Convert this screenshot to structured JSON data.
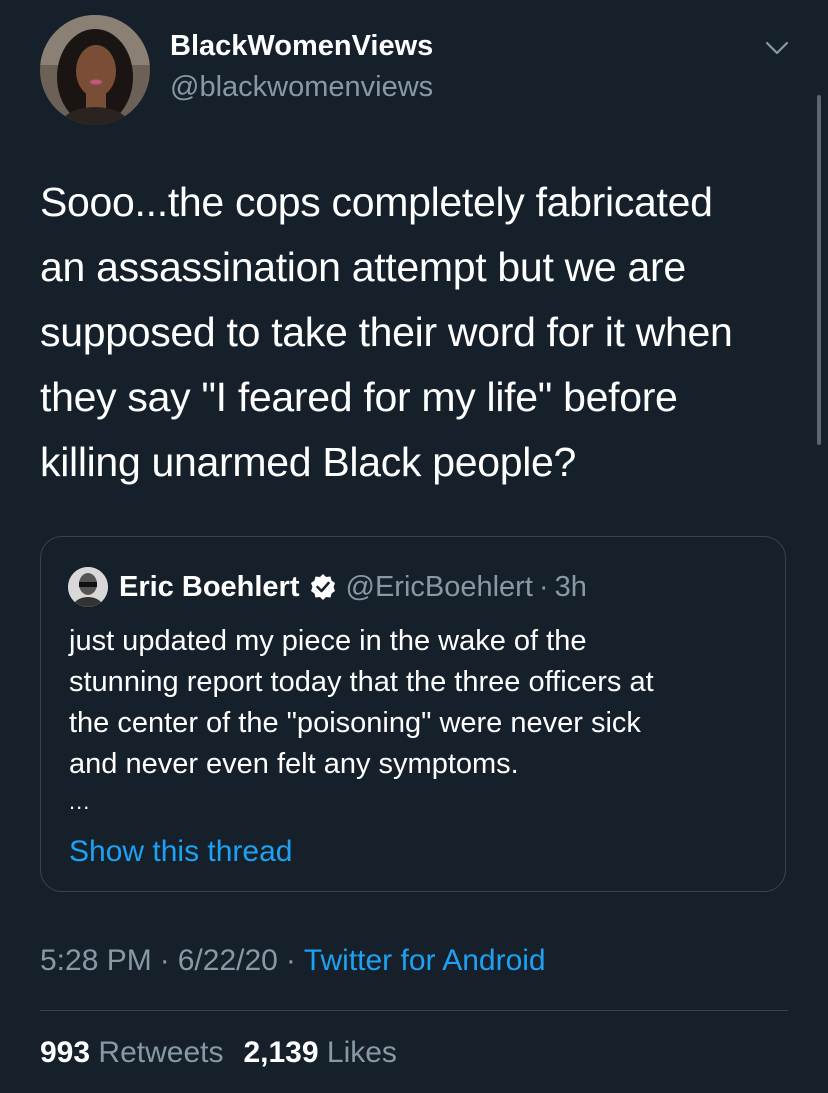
{
  "author": {
    "display_name": "BlackWomenViews",
    "handle": "@blackwomenviews"
  },
  "tweet": {
    "lines": [
      "Sooo...the cops completely fabricated",
      "an assassination attempt but we are",
      "supposed to take their word for it when",
      "they say \"I feared for my life\" before",
      "killing unarmed Black people?"
    ]
  },
  "quote": {
    "display_name": "Eric Boehlert",
    "handle": "@EricBoehlert",
    "separator": "·",
    "time": "3h",
    "lines": [
      "just updated my piece in the wake of the",
      "stunning report today that the three officers at",
      "the center of the \"poisoning\" were never sick",
      "and never even felt any symptoms."
    ],
    "ellipsis": "...",
    "show_thread": "Show this thread"
  },
  "meta": {
    "time": "5:28 PM",
    "date": "6/22/20",
    "separator": "·",
    "source": "Twitter for Android"
  },
  "stats": {
    "retweets_count": "993",
    "retweets_label": "Retweets",
    "likes_count": "2,139",
    "likes_label": "Likes"
  },
  "colors": {
    "background": "#15202b",
    "primary_text": "#ffffff",
    "secondary_text": "#8899a6",
    "link": "#1da1f2",
    "border": "#38444d"
  },
  "icons": {
    "caret": "chevron-down-icon",
    "verified": "verified-badge-icon"
  }
}
